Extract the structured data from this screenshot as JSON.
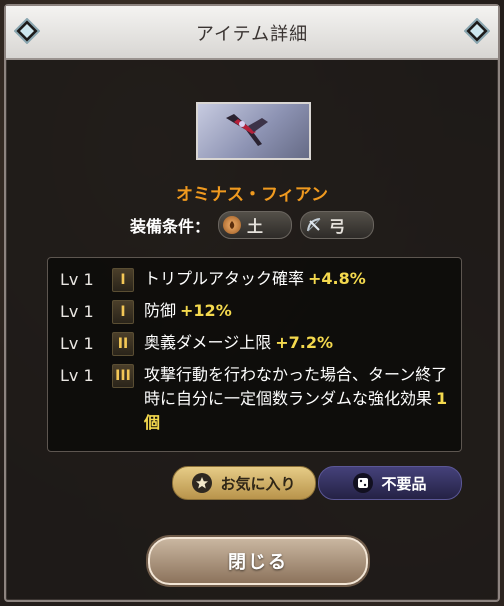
{
  "header": {
    "title": "アイテム詳細"
  },
  "item": {
    "name": "オミナス・フィアン"
  },
  "equip": {
    "label": "装備条件：",
    "element": "土",
    "weapon": "弓"
  },
  "skills": [
    {
      "level": "Lv 1",
      "rank": "I",
      "text": "トリプルアタック確率",
      "value": "+4.8%"
    },
    {
      "level": "Lv 1",
      "rank": "I",
      "text": "防御",
      "value": "+12%"
    },
    {
      "level": "Lv 1",
      "rank": "II",
      "text": "奥義ダメージ上限",
      "value": "+7.2%"
    },
    {
      "level": "Lv 1",
      "rank": "III",
      "text": "攻撃行動を行わなかった場合、ターン終了時に自分に一定個数ランダムな強化効果",
      "value": "1個"
    }
  ],
  "buttons": {
    "favorite": "お気に入り",
    "unneeded": "不要品",
    "close": "閉じる"
  },
  "colors": {
    "item_name": "#f09a1f",
    "value_highlight": "#f4d94e",
    "favorite_button": "#d4b36a",
    "unneeded_button": "#37336a"
  }
}
